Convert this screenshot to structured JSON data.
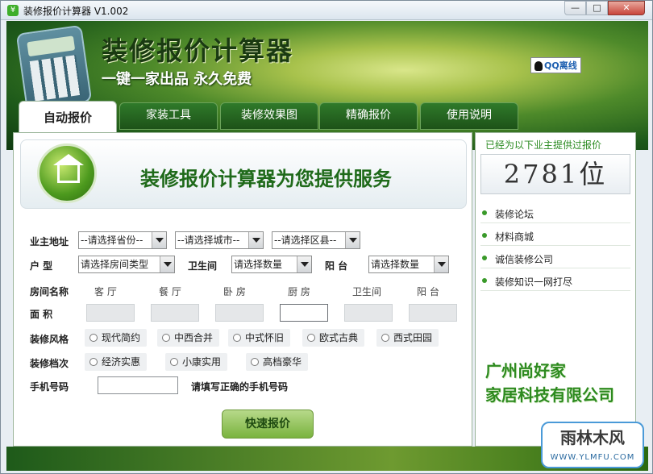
{
  "window": {
    "title": "装修报价计算器  V1.002",
    "min": "—",
    "max": "□",
    "close": "✕"
  },
  "banner": {
    "title": "装修报价计算器",
    "slogan": "一键一家出品 永久免费",
    "qq": "QQ离线"
  },
  "tabs": [
    {
      "label": "自动报价",
      "active": true
    },
    {
      "label": "家装工具"
    },
    {
      "label": "装修效果图"
    },
    {
      "label": "精确报价"
    },
    {
      "label": "使用说明"
    }
  ],
  "service": {
    "text": "装修报价计算器为您提供服务"
  },
  "address": {
    "label": "业主地址",
    "province": "--请选择省份--",
    "city": "--请选择城市--",
    "district": "--请选择区县--"
  },
  "layout": {
    "label": "户    型",
    "value": "请选择房间类型",
    "bath_label": "卫生间",
    "bath_value": "请选择数量",
    "balcony_label": "阳   台",
    "balcony_value": "请选择数量"
  },
  "rooms": {
    "label": "房间名称",
    "names": [
      "客  厅",
      "餐  厅",
      "卧  房",
      "厨  房",
      "卫生间",
      "阳  台"
    ]
  },
  "area": {
    "label": "面    积"
  },
  "style": {
    "label": "装修风格",
    "options": [
      "现代简约",
      "中西合并",
      "中式怀旧",
      "欧式古典",
      "西式田园"
    ]
  },
  "grade": {
    "label": "装修档次",
    "options": [
      "经济实惠",
      "小康实用",
      "高档豪华"
    ]
  },
  "phone": {
    "label": "手机号码",
    "value": "",
    "tip": "请填写正确的手机号码"
  },
  "quote_button": "快速报价",
  "side": {
    "served": "已经为以下业主提供过报价",
    "count": "2781位",
    "links": [
      "装修论坛",
      "材料商城",
      "诚信装修公司",
      "装修知识一网打尽"
    ],
    "company_line1": "广州尚好家",
    "company_line2": "家居科技有限公司"
  },
  "watermark": {
    "top": "雨林木风",
    "url": "WWW.YLMFU.COM"
  }
}
